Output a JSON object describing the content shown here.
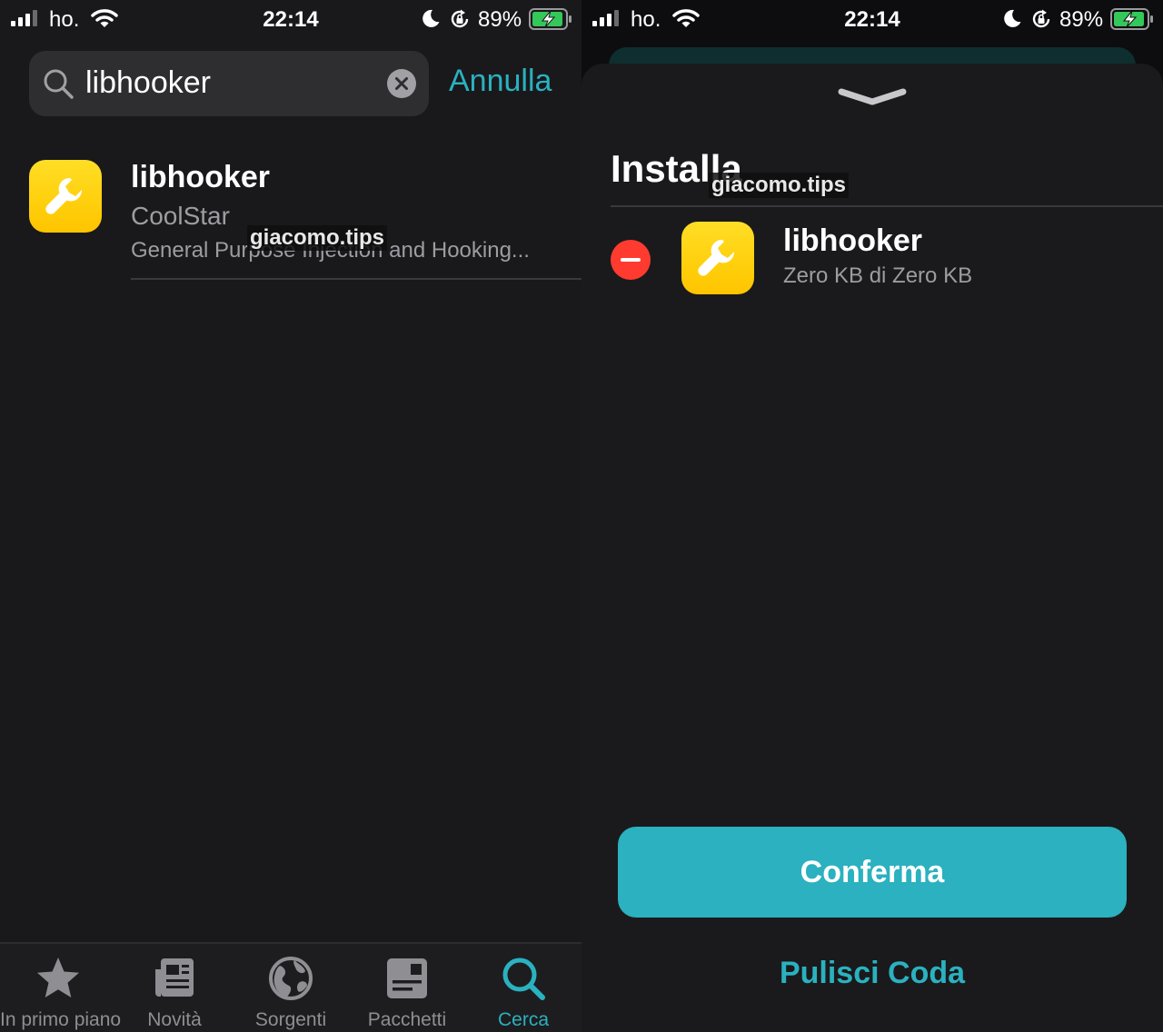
{
  "status_bar": {
    "carrier": "ho.",
    "time": "22:14",
    "battery_percent": "89%"
  },
  "left": {
    "search": {
      "value": "libhooker",
      "cancel_label": "Annulla"
    },
    "result": {
      "name": "libhooker",
      "author": "CoolStar",
      "description": "General Purpose Injection and Hooking..."
    },
    "watermark": "giacomo.tips",
    "tabs": [
      {
        "label": "In primo piano",
        "icon": "star-icon",
        "active": false
      },
      {
        "label": "Novità",
        "icon": "newspaper-icon",
        "active": false
      },
      {
        "label": "Sorgenti",
        "icon": "globe-icon",
        "active": false
      },
      {
        "label": "Pacchetti",
        "icon": "package-icon",
        "active": false
      },
      {
        "label": "Cerca",
        "icon": "search-icon",
        "active": true
      }
    ]
  },
  "right": {
    "sheet_title": "Installa",
    "watermark": "giacomo.tips",
    "queue_item": {
      "name": "libhooker",
      "size": "Zero KB di Zero KB"
    },
    "confirm_label": "Conferma",
    "clear_queue_label": "Pulisci Coda"
  },
  "colors": {
    "accent": "#2bb1bf",
    "background": "#19191b",
    "remove": "#ff3b30",
    "icon_yellow": "#ffcf0c"
  }
}
